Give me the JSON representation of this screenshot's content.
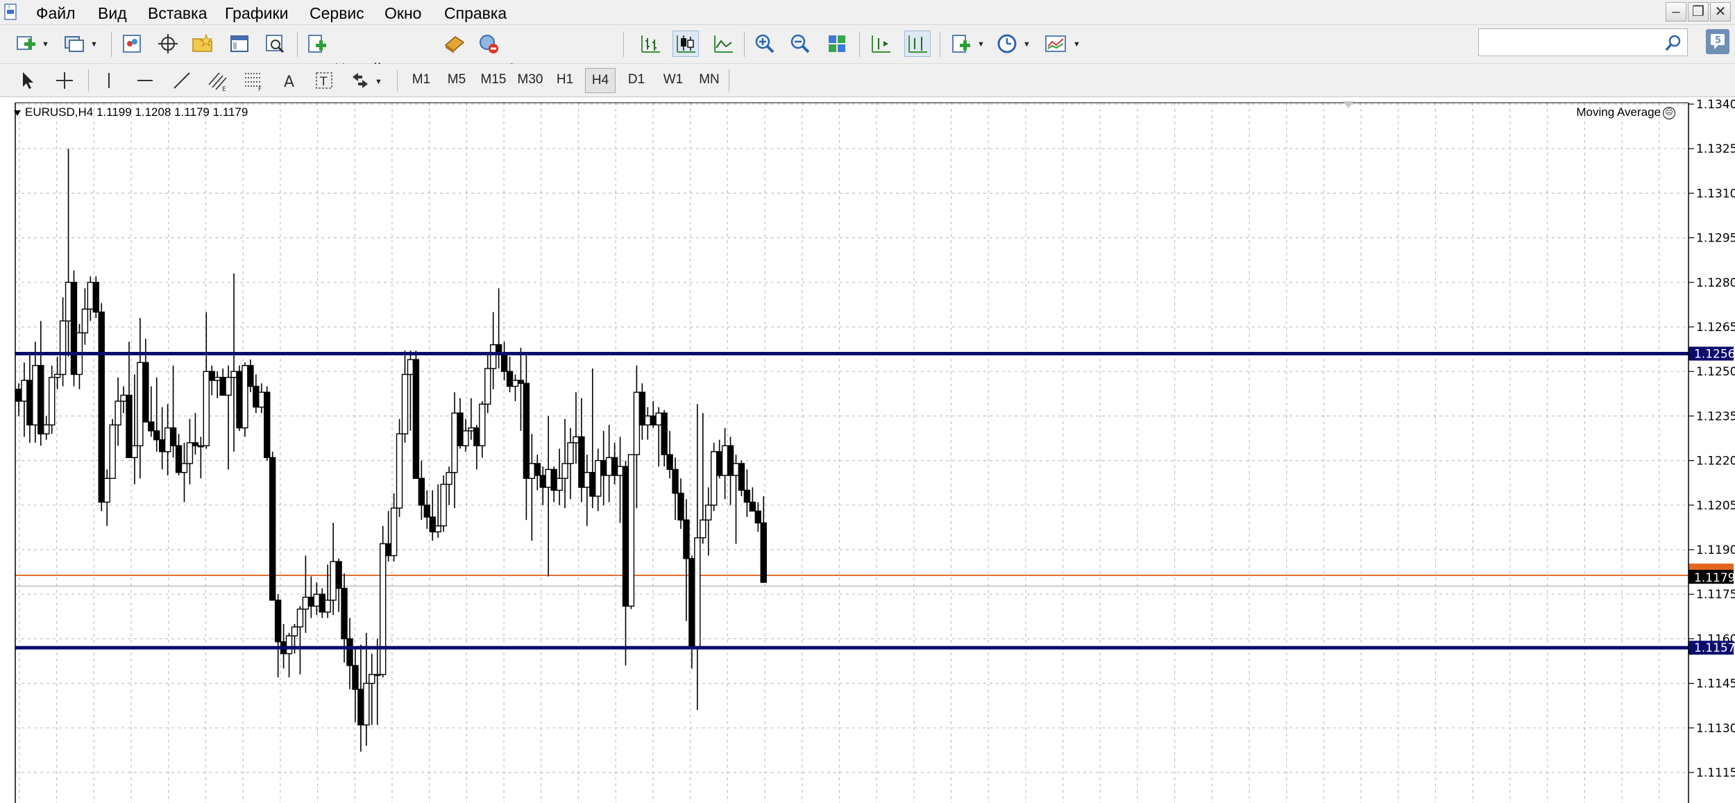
{
  "menu": {
    "items": [
      "Файл",
      "Вид",
      "Вставка",
      "Графики",
      "Сервис",
      "Окно",
      "Справка"
    ]
  },
  "window_controls": {
    "minimize": "–",
    "restore": "❐",
    "close": "✕"
  },
  "toolbar": {
    "new_order_label": "Новый ордер",
    "auto_trading_label": "Авто-торговля"
  },
  "timeframes": [
    "M1",
    "M5",
    "M15",
    "M30",
    "H1",
    "H4",
    "D1",
    "W1",
    "MN"
  ],
  "active_timeframe": "H4",
  "search": {
    "placeholder": ""
  },
  "chart": {
    "header": "EURUSD,H4  1.1199 1.1208 1.1179 1.1179",
    "indicator_label": "Moving Average"
  },
  "colors": {
    "bull_body": "#ffffff",
    "bear_body": "#000000",
    "grid": "#c0c0c0",
    "support_resistance": "#0b0b6e",
    "price_line": "#e2661e",
    "accent_blue": "#2e6fc9"
  },
  "chart_data": {
    "type": "candlestick",
    "symbol": "EURUSD",
    "timeframe": "H4",
    "y_ticks": [
      1.134,
      1.1325,
      1.131,
      1.1295,
      1.128,
      1.1265,
      1.125,
      1.1235,
      1.122,
      1.1205,
      1.119,
      1.1175,
      1.116,
      1.1145,
      1.113,
      1.1115
    ],
    "ylim": [
      1.1113,
      1.1343
    ],
    "grid": true,
    "horizontal_lines": [
      {
        "price": 1.1256,
        "label": "1.1256",
        "color": "#0b0b6e"
      },
      {
        "price": 1.1157,
        "label": "1.1157",
        "color": "#0b0b6e"
      }
    ],
    "current_price": {
      "price": 1.1179,
      "label": "1.1179"
    },
    "ask_line": {
      "price": 1.1181
    },
    "candles": [
      [
        1.1244,
        1.1246,
        1.1235,
        1.124
      ],
      [
        1.124,
        1.1253,
        1.1228,
        1.1247
      ],
      [
        1.1247,
        1.1256,
        1.1226,
        1.1232
      ],
      [
        1.1232,
        1.126,
        1.1226,
        1.1252
      ],
      [
        1.1252,
        1.1267,
        1.1225,
        1.1229
      ],
      [
        1.1229,
        1.1235,
        1.1227,
        1.1232
      ],
      [
        1.1232,
        1.1252,
        1.1229,
        1.1248
      ],
      [
        1.1248,
        1.1255,
        1.1244,
        1.1249
      ],
      [
        1.1249,
        1.1275,
        1.1245,
        1.1267
      ],
      [
        1.1267,
        1.1325,
        1.1255,
        1.128
      ],
      [
        1.128,
        1.1284,
        1.1245,
        1.1249
      ],
      [
        1.1249,
        1.1266,
        1.1244,
        1.1263
      ],
      [
        1.1263,
        1.1278,
        1.1259,
        1.1271
      ],
      [
        1.1271,
        1.1282,
        1.1267,
        1.128
      ],
      [
        1.128,
        1.1282,
        1.1268,
        1.127
      ],
      [
        1.127,
        1.1273,
        1.1203,
        1.1206
      ],
      [
        1.1206,
        1.1217,
        1.1198,
        1.1214
      ],
      [
        1.1214,
        1.1234,
        1.1214,
        1.1232
      ],
      [
        1.1232,
        1.1248,
        1.1225,
        1.124
      ],
      [
        1.124,
        1.1245,
        1.1236,
        1.1242
      ],
      [
        1.1242,
        1.126,
        1.1221,
        1.1221
      ],
      [
        1.1221,
        1.1249,
        1.1212,
        1.1225
      ],
      [
        1.1225,
        1.1268,
        1.1214,
        1.1253
      ],
      [
        1.1253,
        1.1261,
        1.1233,
        1.1233
      ],
      [
        1.1233,
        1.1245,
        1.1228,
        1.123
      ],
      [
        1.123,
        1.1248,
        1.1223,
        1.1227
      ],
      [
        1.1227,
        1.1238,
        1.1217,
        1.1223
      ],
      [
        1.1223,
        1.1239,
        1.1215,
        1.1231
      ],
      [
        1.1231,
        1.1252,
        1.1221,
        1.1225
      ],
      [
        1.1225,
        1.1229,
        1.1215,
        1.1216
      ],
      [
        1.1216,
        1.1226,
        1.1206,
        1.1219
      ],
      [
        1.1219,
        1.1234,
        1.1212,
        1.1226
      ],
      [
        1.1226,
        1.1236,
        1.1222,
        1.1225
      ],
      [
        1.1225,
        1.1228,
        1.1214,
        1.1225
      ],
      [
        1.1225,
        1.127,
        1.1224,
        1.125
      ],
      [
        1.125,
        1.1252,
        1.1242,
        1.1247
      ],
      [
        1.1247,
        1.125,
        1.1241,
        1.1248
      ],
      [
        1.1248,
        1.1251,
        1.1242,
        1.1242
      ],
      [
        1.1242,
        1.1252,
        1.1217,
        1.1248
      ],
      [
        1.1248,
        1.1283,
        1.1223,
        1.125
      ],
      [
        1.125,
        1.1252,
        1.123,
        1.1231
      ],
      [
        1.1231,
        1.1253,
        1.1228,
        1.1252
      ],
      [
        1.1252,
        1.1254,
        1.1243,
        1.1245
      ],
      [
        1.1245,
        1.1249,
        1.1236,
        1.1238
      ],
      [
        1.1238,
        1.1246,
        1.1236,
        1.1243
      ],
      [
        1.1243,
        1.1245,
        1.122,
        1.1221
      ],
      [
        1.1221,
        1.1223,
        1.1173,
        1.1173
      ],
      [
        1.1173,
        1.1175,
        1.1147,
        1.1159
      ],
      [
        1.1159,
        1.1165,
        1.115,
        1.1155
      ],
      [
        1.1155,
        1.1162,
        1.1147,
        1.1161
      ],
      [
        1.1161,
        1.1165,
        1.1155,
        1.1164
      ],
      [
        1.1164,
        1.1171,
        1.1148,
        1.117
      ],
      [
        1.117,
        1.1188,
        1.1162,
        1.1174
      ],
      [
        1.1174,
        1.1181,
        1.1167,
        1.1171
      ],
      [
        1.1171,
        1.1179,
        1.1168,
        1.1175
      ],
      [
        1.1175,
        1.1177,
        1.1167,
        1.1169
      ],
      [
        1.1169,
        1.1185,
        1.1167,
        1.1173
      ],
      [
        1.1173,
        1.1199,
        1.1168,
        1.1186
      ],
      [
        1.1186,
        1.1187,
        1.1169,
        1.1177
      ],
      [
        1.1177,
        1.1182,
        1.1152,
        1.116
      ],
      [
        1.116,
        1.1167,
        1.1143,
        1.1151
      ],
      [
        1.1151,
        1.1157,
        1.1132,
        1.1143
      ],
      [
        1.1143,
        1.1158,
        1.1122,
        1.1131
      ],
      [
        1.1131,
        1.1162,
        1.1124,
        1.1145
      ],
      [
        1.1145,
        1.1155,
        1.1131,
        1.1148
      ],
      [
        1.1148,
        1.116,
        1.1131,
        1.1148
      ],
      [
        1.1148,
        1.1198,
        1.1147,
        1.1192
      ],
      [
        1.1192,
        1.1203,
        1.1186,
        1.1188
      ],
      [
        1.1188,
        1.1209,
        1.1186,
        1.1204
      ],
      [
        1.1204,
        1.1234,
        1.1201,
        1.1229
      ],
      [
        1.1229,
        1.1257,
        1.1226,
        1.1249
      ],
      [
        1.1249,
        1.1257,
        1.123,
        1.1254
      ],
      [
        1.1254,
        1.1257,
        1.1214,
        1.1214
      ],
      [
        1.1214,
        1.122,
        1.12,
        1.1205
      ],
      [
        1.1205,
        1.121,
        1.1197,
        1.1201
      ],
      [
        1.1201,
        1.121,
        1.1193,
        1.1196
      ],
      [
        1.1196,
        1.1212,
        1.1194,
        1.1198
      ],
      [
        1.1198,
        1.1215,
        1.1196,
        1.1212
      ],
      [
        1.1212,
        1.1218,
        1.1205,
        1.1216
      ],
      [
        1.1216,
        1.1243,
        1.1204,
        1.1236
      ],
      [
        1.1236,
        1.1241,
        1.1224,
        1.1225
      ],
      [
        1.1225,
        1.1234,
        1.1223,
        1.123
      ],
      [
        1.123,
        1.1241,
        1.1227,
        1.1231
      ],
      [
        1.1231,
        1.1232,
        1.1217,
        1.1225
      ],
      [
        1.1225,
        1.124,
        1.1221,
        1.1239
      ],
      [
        1.1239,
        1.1256,
        1.1236,
        1.1251
      ],
      [
        1.1251,
        1.127,
        1.1244,
        1.1259
      ],
      [
        1.1259,
        1.1278,
        1.1251,
        1.1256
      ],
      [
        1.1256,
        1.126,
        1.1247,
        1.125
      ],
      [
        1.125,
        1.1255,
        1.1243,
        1.1245
      ],
      [
        1.1245,
        1.1249,
        1.124,
        1.1247
      ],
      [
        1.1247,
        1.1258,
        1.123,
        1.1246
      ],
      [
        1.1246,
        1.1256,
        1.12,
        1.1214
      ],
      [
        1.1214,
        1.1229,
        1.1193,
        1.1219
      ],
      [
        1.1219,
        1.1222,
        1.121,
        1.1215
      ],
      [
        1.1215,
        1.1218,
        1.1205,
        1.1211
      ],
      [
        1.1211,
        1.1235,
        1.1181,
        1.1217
      ],
      [
        1.1217,
        1.1218,
        1.1206,
        1.121
      ],
      [
        1.121,
        1.1224,
        1.1205,
        1.1214
      ],
      [
        1.1214,
        1.1234,
        1.1204,
        1.1219
      ],
      [
        1.1219,
        1.1231,
        1.1207,
        1.1226
      ],
      [
        1.1226,
        1.1243,
        1.1219,
        1.1228
      ],
      [
        1.1228,
        1.1241,
        1.1206,
        1.1211
      ],
      [
        1.1211,
        1.1222,
        1.1198,
        1.1216
      ],
      [
        1.1216,
        1.1251,
        1.1204,
        1.1208
      ],
      [
        1.1208,
        1.1224,
        1.1203,
        1.122
      ],
      [
        1.122,
        1.123,
        1.1205,
        1.1215
      ],
      [
        1.1215,
        1.1232,
        1.1206,
        1.1221
      ],
      [
        1.1221,
        1.1226,
        1.1212,
        1.1215
      ],
      [
        1.1215,
        1.1228,
        1.1199,
        1.1218
      ],
      [
        1.1218,
        1.122,
        1.1151,
        1.1171
      ],
      [
        1.1171,
        1.122,
        1.117,
        1.1222
      ],
      [
        1.1222,
        1.1252,
        1.1204,
        1.1243
      ],
      [
        1.1243,
        1.1246,
        1.1227,
        1.1232
      ],
      [
        1.1232,
        1.1238,
        1.1227,
        1.1235
      ],
      [
        1.1235,
        1.124,
        1.1231,
        1.1232
      ],
      [
        1.1232,
        1.1238,
        1.1218,
        1.1236
      ],
      [
        1.1236,
        1.1237,
        1.1218,
        1.1222
      ],
      [
        1.1222,
        1.123,
        1.1214,
        1.1217
      ],
      [
        1.1217,
        1.1221,
        1.12,
        1.1209
      ],
      [
        1.1209,
        1.1214,
        1.1197,
        1.12
      ],
      [
        1.12,
        1.1207,
        1.1166,
        1.1187
      ],
      [
        1.1187,
        1.1188,
        1.115,
        1.1157
      ],
      [
        1.1157,
        1.1239,
        1.1136,
        1.1194
      ],
      [
        1.1194,
        1.1236,
        1.1192,
        1.12
      ],
      [
        1.12,
        1.1211,
        1.1188,
        1.1205
      ],
      [
        1.1205,
        1.1226,
        1.1203,
        1.1223
      ],
      [
        1.1223,
        1.1227,
        1.1214,
        1.1215
      ],
      [
        1.1215,
        1.1231,
        1.1207,
        1.1225
      ],
      [
        1.1225,
        1.1228,
        1.1205,
        1.1215
      ],
      [
        1.1215,
        1.1222,
        1.1192,
        1.1219
      ],
      [
        1.1219,
        1.122,
        1.1208,
        1.121
      ],
      [
        1.121,
        1.1217,
        1.1201,
        1.1206
      ],
      [
        1.1206,
        1.1211,
        1.1203,
        1.1203
      ],
      [
        1.1203,
        1.1206,
        1.1196,
        1.1199
      ],
      [
        1.1199,
        1.1208,
        1.1179,
        1.1179
      ]
    ]
  }
}
